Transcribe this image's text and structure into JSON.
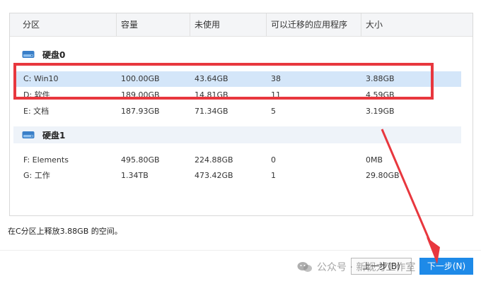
{
  "table": {
    "headers": [
      "分区",
      "容量",
      "未使用",
      "可以迁移的应用程序",
      "大小"
    ],
    "groups": [
      {
        "label": "硬盘0",
        "rows": [
          {
            "partition": "C:  Win10",
            "capacity": "100.00GB",
            "unused": "43.64GB",
            "apps": "38",
            "size": "3.88GB",
            "selected": true
          },
          {
            "partition": "D:  软件",
            "capacity": "189.00GB",
            "unused": "14.81GB",
            "apps": "11",
            "size": "4.59GB",
            "selected": false
          },
          {
            "partition": "E:  文档",
            "capacity": "187.93GB",
            "unused": "71.34GB",
            "apps": "5",
            "size": "3.19GB",
            "selected": false
          }
        ]
      },
      {
        "label": "硬盘1",
        "rows": [
          {
            "partition": "F:  Elements",
            "capacity": "495.80GB",
            "unused": "224.88GB",
            "apps": "0",
            "size": "0MB",
            "selected": false
          },
          {
            "partition": "G:  工作",
            "capacity": "1.34TB",
            "unused": "473.42GB",
            "apps": "1",
            "size": "29.80GB",
            "selected": false
          }
        ]
      }
    ]
  },
  "status_text": "在C分区上释放3.88GB 的空间。",
  "buttons": {
    "prev": "上一步(B)",
    "next": "下一步(N)"
  },
  "watermark": "公众号 · 新视力工作室",
  "colors": {
    "highlight": "#e8373e",
    "selected_row": "#d4e6f9",
    "primary_button": "#1e8ae8"
  }
}
